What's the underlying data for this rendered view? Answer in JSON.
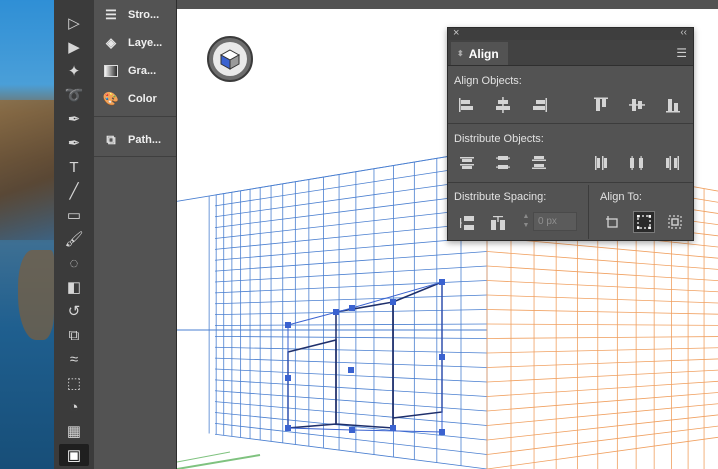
{
  "tools": [
    {
      "name": "selection-tool",
      "glyph": "▷"
    },
    {
      "name": "direct-selection-tool",
      "glyph": "▶"
    },
    {
      "name": "magic-wand-tool",
      "glyph": "✦"
    },
    {
      "name": "lasso-tool",
      "glyph": "➰"
    },
    {
      "name": "pen-tool",
      "glyph": "✒"
    },
    {
      "name": "curvature-tool",
      "glyph": "✒"
    },
    {
      "name": "type-tool",
      "glyph": "T"
    },
    {
      "name": "line-tool",
      "glyph": "╱"
    },
    {
      "name": "rectangle-tool",
      "glyph": "▭"
    },
    {
      "name": "paintbrush-tool",
      "glyph": "🖌"
    },
    {
      "name": "shaper-tool",
      "glyph": "◌"
    },
    {
      "name": "eraser-tool",
      "glyph": "◧"
    },
    {
      "name": "rotate-tool",
      "glyph": "↺"
    },
    {
      "name": "scale-tool",
      "glyph": "⧉"
    },
    {
      "name": "width-tool",
      "glyph": "≈"
    },
    {
      "name": "free-transform-tool",
      "glyph": "⬚"
    },
    {
      "name": "shape-builder-tool",
      "glyph": "◔"
    },
    {
      "name": "perspective-grid-tool",
      "glyph": "▦"
    },
    {
      "name": "perspective-selection-tool",
      "glyph": "▣"
    }
  ],
  "dock": {
    "items": [
      {
        "label": "Stro...",
        "icon": "stroke-icon"
      },
      {
        "label": "Laye...",
        "icon": "layers-icon"
      },
      {
        "label": "Gra...",
        "icon": "gradient-icon"
      },
      {
        "label": "Color",
        "icon": "color-icon"
      },
      {
        "label": "Path...",
        "icon": "pathfinder-icon"
      }
    ]
  },
  "align_panel": {
    "tab_label": "Align",
    "align_objects_label": "Align Objects:",
    "distribute_objects_label": "Distribute Objects:",
    "distribute_spacing_label": "Distribute Spacing:",
    "align_to_label": "Align To:",
    "spacing_value": "0 px",
    "align_objects_buttons": [
      "horizontal-align-left",
      "horizontal-align-center",
      "horizontal-align-right",
      "vertical-align-top",
      "vertical-align-center",
      "vertical-align-bottom"
    ],
    "distribute_objects_buttons": [
      "vertical-distribute-top",
      "vertical-distribute-center",
      "vertical-distribute-bottom",
      "horizontal-distribute-left",
      "horizontal-distribute-center",
      "horizontal-distribute-right"
    ],
    "distribute_spacing_buttons": [
      "vertical-distribute-space",
      "horizontal-distribute-space"
    ],
    "align_to_buttons": [
      "align-to-artboard",
      "align-to-selection",
      "align-to-key-object"
    ],
    "align_to_active": "align-to-selection"
  },
  "colors": {
    "left_grid": "#4a7fd0",
    "right_grid": "#f0a060",
    "ground_grid": "#7fc27f",
    "selection": "#3a62d0",
    "panel_bg": "#535353",
    "toolbar_bg": "#3b3b3b"
  }
}
